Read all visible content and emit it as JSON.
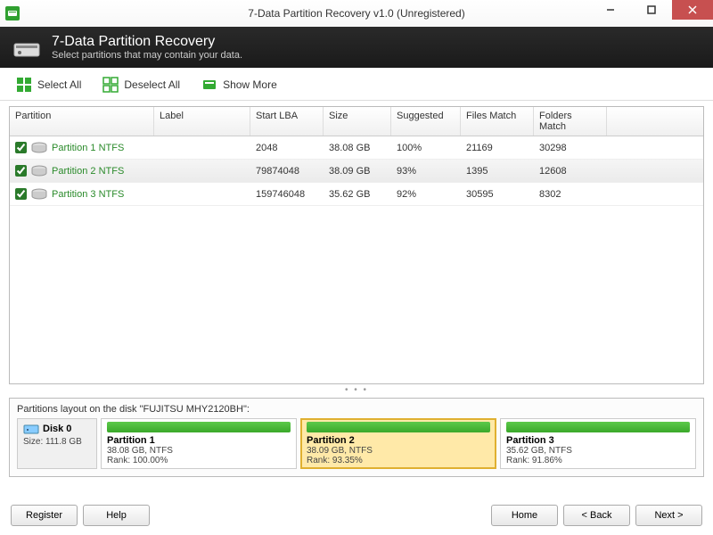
{
  "window": {
    "title": "7-Data Partition Recovery v1.0 (Unregistered)"
  },
  "header": {
    "title": "7-Data Partition Recovery",
    "subtitle": "Select partitions that may contain your data."
  },
  "toolbar": {
    "select_all": "Select All",
    "deselect_all": "Deselect All",
    "show_more": "Show More"
  },
  "columns": {
    "partition": "Partition",
    "label": "Label",
    "start_lba": "Start LBA",
    "size": "Size",
    "suggested": "Suggested",
    "files_match": "Files Match",
    "folders_match": "Folders Match"
  },
  "rows": [
    {
      "checked": true,
      "name": "Partition 1 NTFS",
      "label": "",
      "start_lba": "2048",
      "size": "38.08 GB",
      "suggested": "100%",
      "files": "21169",
      "folders": "30298",
      "selected": false
    },
    {
      "checked": true,
      "name": "Partition 2 NTFS",
      "label": "",
      "start_lba": "79874048",
      "size": "38.09 GB",
      "suggested": "93%",
      "files": "1395",
      "folders": "12608",
      "selected": true
    },
    {
      "checked": true,
      "name": "Partition 3 NTFS",
      "label": "",
      "start_lba": "159746048",
      "size": "35.62 GB",
      "suggested": "92%",
      "files": "30595",
      "folders": "8302",
      "selected": false
    }
  ],
  "layout": {
    "title": "Partitions layout on the disk \"FUJITSU MHY2120BH\":",
    "disk": {
      "name": "Disk 0",
      "size": "Size: 111.8 GB"
    },
    "parts": [
      {
        "name": "Partition 1",
        "detail": "38.08 GB, NTFS",
        "rank": "Rank: 100.00%",
        "selected": false
      },
      {
        "name": "Partition 2",
        "detail": "38.09 GB, NTFS",
        "rank": "Rank: 93.35%",
        "selected": true
      },
      {
        "name": "Partition 3",
        "detail": "35.62 GB, NTFS",
        "rank": "Rank: 91.86%",
        "selected": false
      }
    ]
  },
  "footer": {
    "register": "Register",
    "help": "Help",
    "home": "Home",
    "back": "< Back",
    "next": "Next >"
  }
}
